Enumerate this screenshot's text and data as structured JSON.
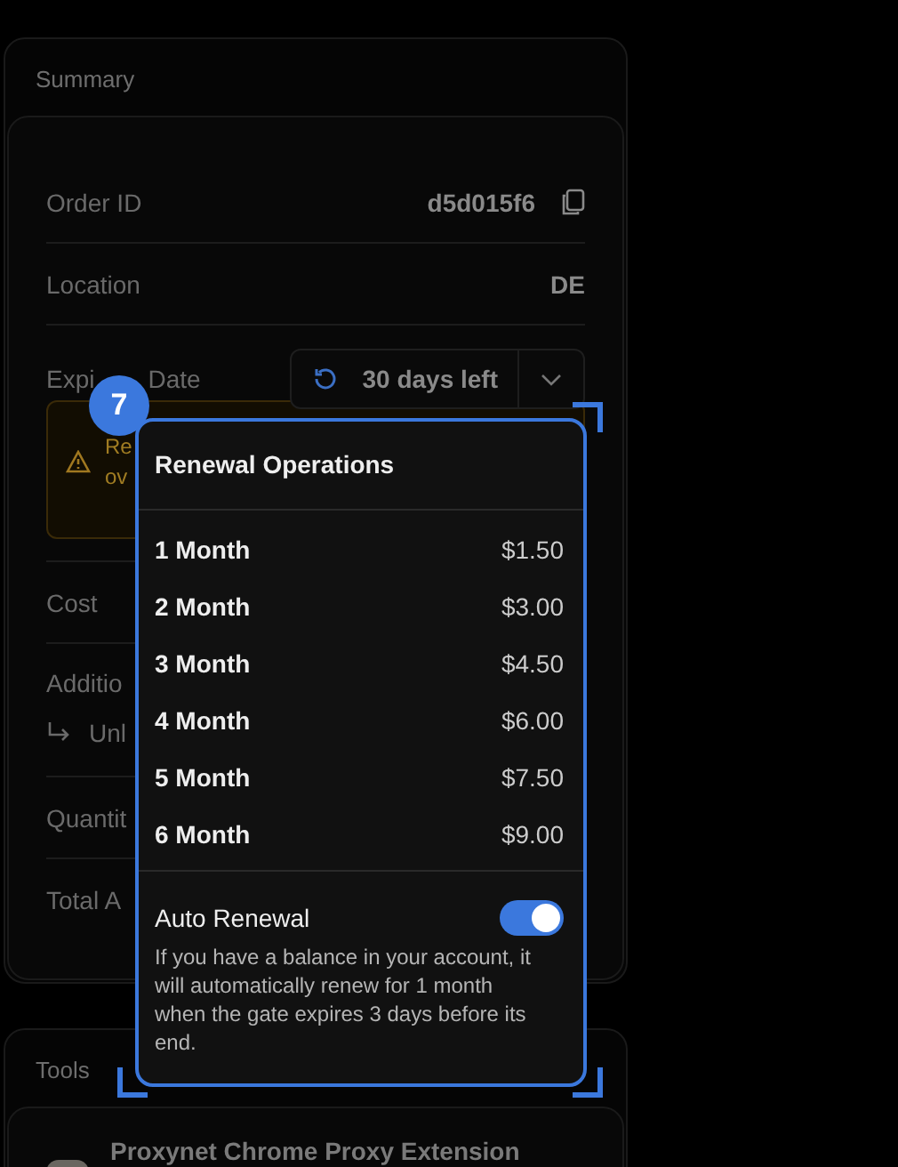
{
  "summary": {
    "title": "Summary",
    "rows": [
      {
        "kind": "copy",
        "label": "Order ID",
        "value": "d5d015f6"
      },
      {
        "kind": "text",
        "label": "Location",
        "value": "DE"
      },
      {
        "kind": "expiry",
        "label_parts": [
          "Expi",
          "Date"
        ],
        "value": "30 days left"
      },
      {
        "kind": "warning",
        "lines": [
          "Re",
          "ov"
        ]
      },
      {
        "kind": "text",
        "label": "Cost"
      },
      {
        "kind": "sub",
        "label": "Additio",
        "sub": "Unl"
      },
      {
        "kind": "text",
        "label": "Quantit"
      },
      {
        "kind": "text",
        "label": "Total A"
      }
    ]
  },
  "tools": {
    "title": "Tools",
    "items": [
      {
        "name": "Proxynet Chrome Proxy Extension"
      }
    ]
  },
  "badge": "7",
  "renewal": {
    "title": "Renewal Operations",
    "options": [
      {
        "label": "1 Month",
        "price": "$1.50"
      },
      {
        "label": "2 Month",
        "price": "$3.00"
      },
      {
        "label": "3 Month",
        "price": "$4.50"
      },
      {
        "label": "4 Month",
        "price": "$6.00"
      },
      {
        "label": "5 Month",
        "price": "$7.50"
      },
      {
        "label": "6 Month",
        "price": "$9.00"
      }
    ],
    "auto_renewal": {
      "label": "Auto Renewal",
      "on": true,
      "description": "If you have a balance in your account, it will automatically renew for 1 month when the gate expires 3 days before its end."
    }
  }
}
